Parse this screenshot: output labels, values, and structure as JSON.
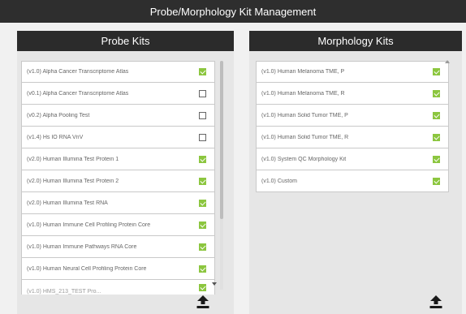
{
  "window": {
    "title": "Probe/Morphology Kit Management"
  },
  "probe_panel": {
    "title": "Probe Kits",
    "items": [
      {
        "label": "(v1.0) Alpha Cancer Transcriptome Atlas",
        "checked": true
      },
      {
        "label": "(v0.1) Alpha Cancer Transcriptome Atlas",
        "checked": false
      },
      {
        "label": "(v0.2) Alpha Pooling Test",
        "checked": false
      },
      {
        "label": "(v1.4) Hs IO RNA VnV",
        "checked": false
      },
      {
        "label": "(v2.0) Human Illumina Test Protein 1",
        "checked": true
      },
      {
        "label": "(v2.0) Human Illumina Test Protein 2",
        "checked": true
      },
      {
        "label": "(v2.0) Human Illumina Test RNA",
        "checked": true
      },
      {
        "label": "(v1.0) Human Immune Cell Profiling Protein Core",
        "checked": true
      },
      {
        "label": "(v1.0) Human Immune Pathways RNA Core",
        "checked": true
      },
      {
        "label": "(v1.0) Human Neural Cell Profiling Protein Core",
        "checked": true
      },
      {
        "label": "(v1.0) HMS_213_TEST Pro...",
        "checked": true
      }
    ]
  },
  "morphology_panel": {
    "title": "Morphology Kits",
    "items": [
      {
        "label": "(v1.0) Human Melanoma TME, P",
        "checked": true
      },
      {
        "label": "(v1.0) Human Melanoma TME, R",
        "checked": true
      },
      {
        "label": "(v1.0) Human Solid Tumor TME, P",
        "checked": true
      },
      {
        "label": "(v1.0) Human Solid Tumor TME, R",
        "checked": true
      },
      {
        "label": "(v1.0) System QC Morphology Kit",
        "checked": true
      },
      {
        "label": "(v1.0) Custom",
        "checked": true
      }
    ]
  },
  "icons": {
    "upload": "upload-icon",
    "scroll_up": "scroll-up-arrow-icon",
    "scroll_down": "scroll-down-arrow-icon",
    "checkbox": "checkbox-icon"
  },
  "colors": {
    "titlebar_bg": "#2e2e2e",
    "panel_header_bg": "#2b2b2b",
    "checkbox_on": "#8cc63f"
  }
}
